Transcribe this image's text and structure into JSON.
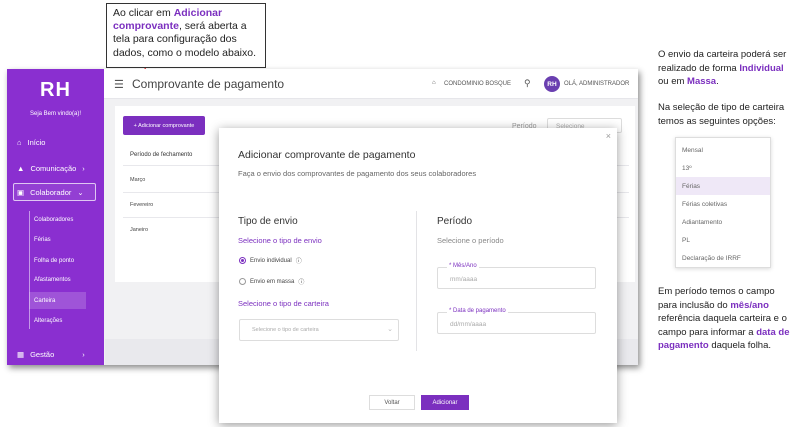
{
  "callout": {
    "line1": "Ao clicar em ",
    "highlight": "Adicionar comprovante",
    "line2": ", será aberta a tela para configuração dos dados, como o modelo abaixo."
  },
  "sidebar": {
    "logo": "RH",
    "welcome": "Seja Bem vindo(a)!",
    "items": [
      {
        "label": "Início",
        "icon": "home-icon"
      },
      {
        "label": "Comunicação",
        "icon": "megaphone-icon"
      },
      {
        "label": "Colaborador",
        "icon": "id-card-icon"
      },
      {
        "label": "Gestão",
        "icon": "briefcase-icon"
      }
    ],
    "sub_items": [
      "Colaboradores",
      "Férias",
      "Folha de ponto",
      "Afastamentos",
      "Carteira",
      "Alterações"
    ]
  },
  "topbar": {
    "title": "Comprovante de pagamento",
    "company": "CONDOMINIO BOSQUE",
    "avatar": "RH",
    "greeting": "OLÁ, ADMINISTRADOR"
  },
  "list": {
    "add_button": "+ Adicionar comprovante",
    "periodo_label": "Período",
    "periodo_placeholder": "Selecione",
    "column_header": "Período de fechamento",
    "rows": [
      "Março",
      "Fevereiro",
      "Janeiro"
    ]
  },
  "modal": {
    "close": "×",
    "title": "Adicionar comprovante de pagamento",
    "subtitle": "Faça o envio dos comprovantes de pagamento dos seus colaboradores",
    "envio_title": "Tipo de envio",
    "envio_subtitle": "Selecione o tipo de envio",
    "radio_individual": "Envio individual",
    "radio_massa": "Envio em massa",
    "carteira_subtitle": "Selecione o tipo de carteira",
    "carteira_placeholder": "Selecione o tipo de carteira",
    "periodo_title": "Período",
    "periodo_subtitle": "Selecione o período",
    "mes_label": "* Mês/Ano",
    "mes_placeholder": "mm/aaaa",
    "data_label": "* Data de pagamento",
    "data_placeholder": "dd/mm/aaaa",
    "btn_voltar": "Voltar",
    "btn_adicionar": "Adicionar"
  },
  "right_panel": {
    "p1_a": "O envio da carteira poderá ser realizado de forma ",
    "p1_hl1": "Individual",
    "p1_b": " ou em ",
    "p1_hl2": "Massa",
    "p1_c": ".",
    "p2": "Na seleção de tipo de carteira temos as seguintes opções:",
    "options": [
      "Mensal",
      "13º",
      "Férias",
      "Férias coletivas",
      "Adiantamento",
      "PL",
      "Declaração de IRRF"
    ],
    "p3_a": "Em período temos o campo para inclusão do ",
    "p3_hl1": "mês/ano",
    "p3_b": " referência daquela carteira e o campo para informar a ",
    "p3_hl2": "data de pagamento",
    "p3_c": " daquela folha."
  },
  "colors": {
    "accent": "#7b2fbf",
    "sidebar": "#8a2fd0"
  }
}
